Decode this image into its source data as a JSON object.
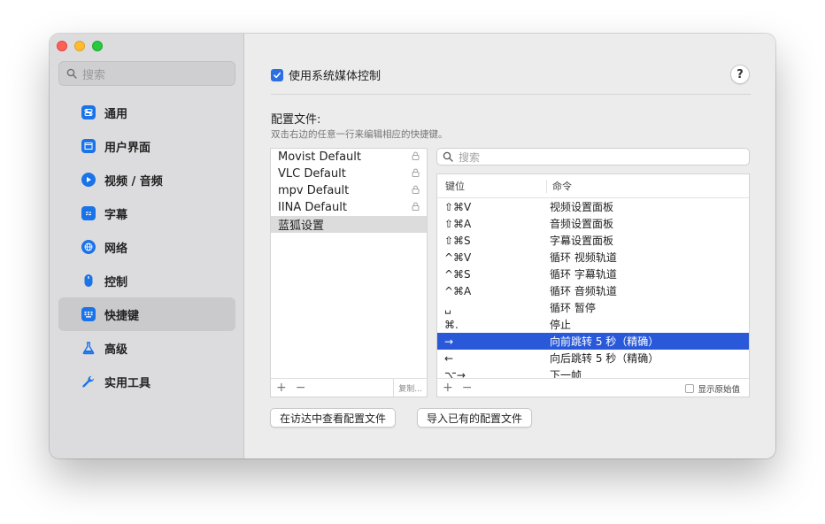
{
  "sidebar": {
    "search_placeholder": "搜索",
    "items": [
      {
        "label": "通用",
        "icon": "toggle-icon"
      },
      {
        "label": "用户界面",
        "icon": "window-icon"
      },
      {
        "label": "视频 / 音频",
        "icon": "play-icon"
      },
      {
        "label": "字幕",
        "icon": "subtitle-icon"
      },
      {
        "label": "网络",
        "icon": "globe-icon"
      },
      {
        "label": "控制",
        "icon": "mouse-icon"
      },
      {
        "label": "快捷键",
        "icon": "keyboard-icon",
        "active": true
      },
      {
        "label": "高级",
        "icon": "flask-icon"
      },
      {
        "label": "实用工具",
        "icon": "wrench-icon"
      }
    ]
  },
  "main": {
    "media_control_label": "使用系统媒体控制",
    "media_control_checked": true,
    "help_label": "?",
    "section_title": "配置文件:",
    "section_subtitle": "双击右边的任意一行来编辑相应的快捷键。",
    "profiles": [
      {
        "name": "Movist Default",
        "locked": true
      },
      {
        "name": "VLC Default",
        "locked": true
      },
      {
        "name": "mpv Default",
        "locked": true
      },
      {
        "name": "IINA Default",
        "locked": true
      },
      {
        "name": "蓝狐设置",
        "locked": false,
        "selected": true
      }
    ],
    "profile_add": "+",
    "profile_remove": "−",
    "duplicate_label": "复制...",
    "search_placeholder": "搜索",
    "table_headers": {
      "key": "键位",
      "command": "命令"
    },
    "bindings": [
      {
        "key": "⇧⌘V",
        "command": "视频设置面板"
      },
      {
        "key": "⇧⌘A",
        "command": "音频设置面板"
      },
      {
        "key": "⇧⌘S",
        "command": "字幕设置面板"
      },
      {
        "key": "^⌘V",
        "command": "循环 视频轨道"
      },
      {
        "key": "^⌘S",
        "command": "循环 字幕轨道"
      },
      {
        "key": "^⌘A",
        "command": "循环 音频轨道"
      },
      {
        "key": "␣",
        "command": "循环 暂停"
      },
      {
        "key": "⌘.",
        "command": "停止"
      },
      {
        "key": "→",
        "command": "向前跳转 5 秒（精确）",
        "selected": true
      },
      {
        "key": "←",
        "command": "向后跳转 5 秒（精确）"
      },
      {
        "key": "⌥→",
        "command": "下一帧"
      }
    ],
    "binding_add": "+",
    "binding_remove": "−",
    "show_raw_label": "显示原始值",
    "reveal_button": "在访达中查看配置文件",
    "import_button": "导入已有的配置文件"
  },
  "colors": {
    "accent": "#2b6fe3",
    "selection": "#2959d9",
    "sidebar_bg": "#dcdcdf",
    "window_bg": "#ececec"
  }
}
